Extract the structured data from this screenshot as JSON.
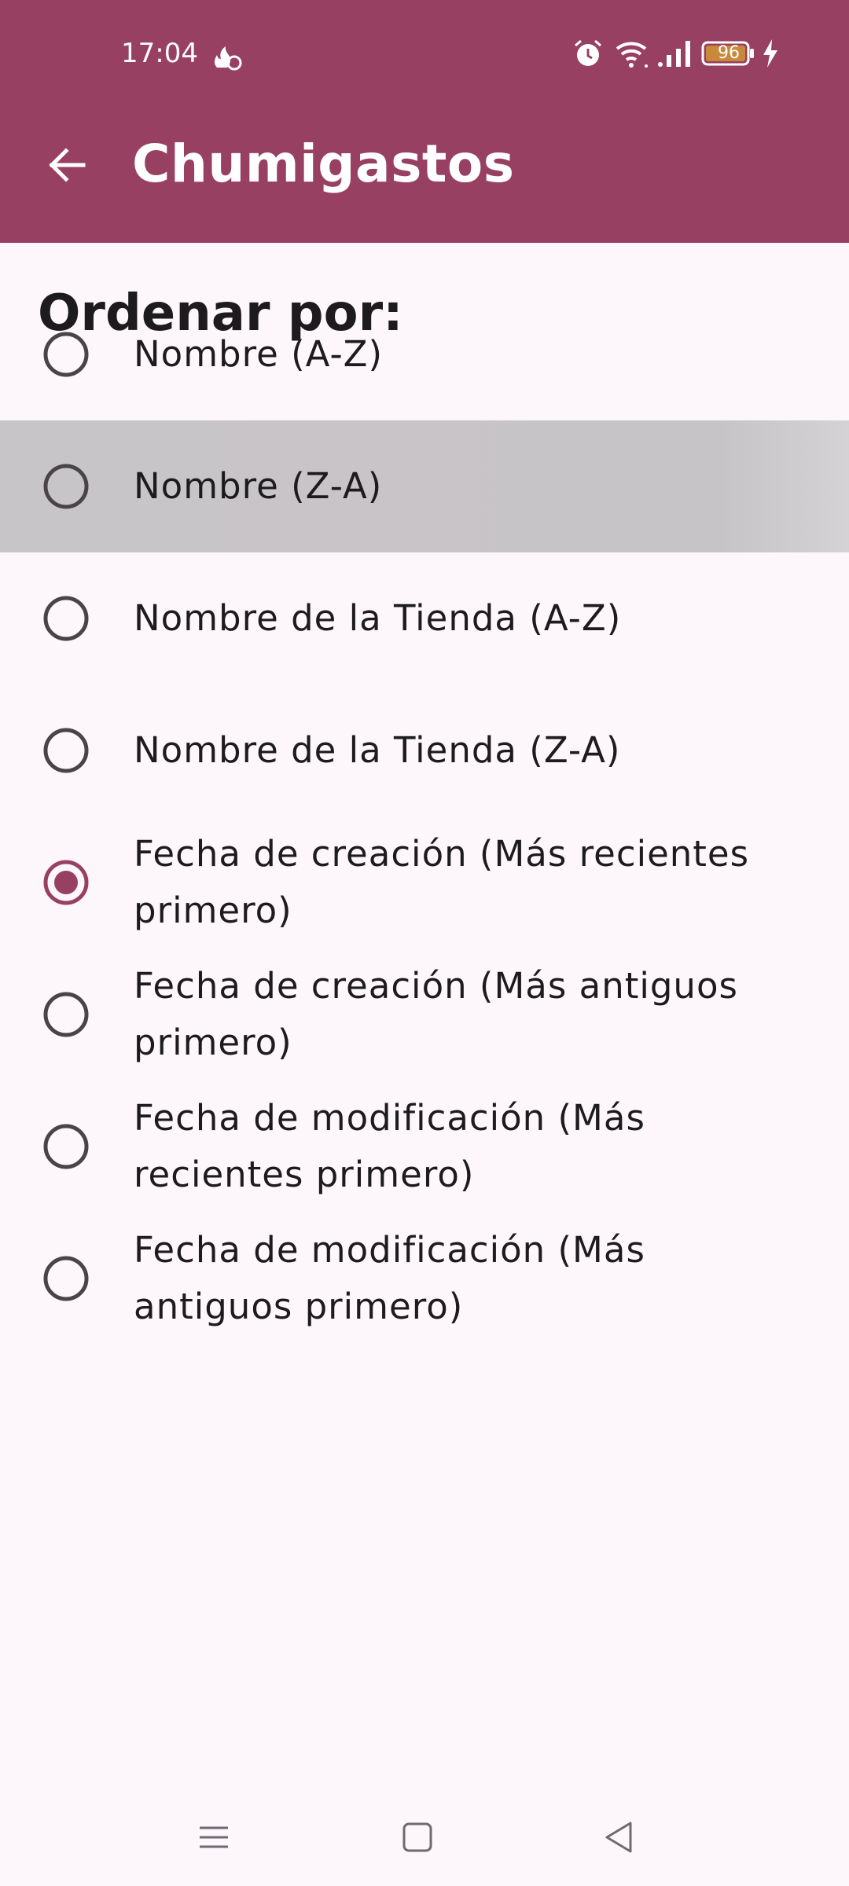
{
  "status_bar": {
    "time": "17:04",
    "battery": "96",
    "icons": [
      "fire-icon",
      "alarm-icon",
      "wifi-icon",
      "signal-icon",
      "battery-icon",
      "charging-icon"
    ]
  },
  "app_bar": {
    "back_icon": "arrow-left-icon",
    "title": "Chumigastos",
    "color": "#974062"
  },
  "sort": {
    "heading": "Ordenar por:",
    "options": [
      {
        "label": "Nombre (A-Z)",
        "selected": false
      },
      {
        "label": "Nombre (Z-A)",
        "selected": false
      },
      {
        "label": "Nombre de la Tienda (A-Z)",
        "selected": false
      },
      {
        "label": "Nombre de la Tienda (Z-A)",
        "selected": false
      },
      {
        "label": "Fecha de creación (Más recientes primero)",
        "selected": true
      },
      {
        "label": "Fecha de creación (Más antiguos primero)",
        "selected": false
      },
      {
        "label": "Fecha de modificación (Más recientes primero)",
        "selected": false
      },
      {
        "label": "Fecha de modificación (Más antiguos primero)",
        "selected": false
      }
    ]
  },
  "nav_bar": {
    "icons": [
      "menu-icon",
      "home-square-icon",
      "back-triangle-icon"
    ]
  }
}
